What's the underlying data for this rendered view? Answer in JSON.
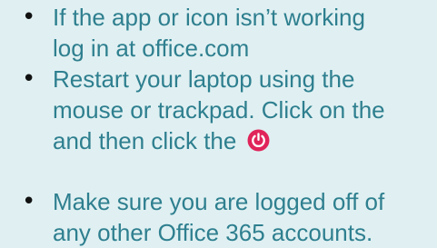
{
  "bullets": [
    {
      "lines": [
        "If the app or icon isn’t working",
        "log in at office.com"
      ]
    },
    {
      "lines": [
        "Restart your laptop using the",
        "mouse or trackpad.  Click on the",
        "and then click the"
      ],
      "icon": "power-icon"
    },
    {
      "lines": [
        "Make sure you are logged off of",
        "any other Office 365 accounts."
      ]
    }
  ],
  "colors": {
    "background": "#e0f0f2",
    "text": "#2e7f8f",
    "bullet": "#111111",
    "icon_fill": "#e0245a"
  }
}
